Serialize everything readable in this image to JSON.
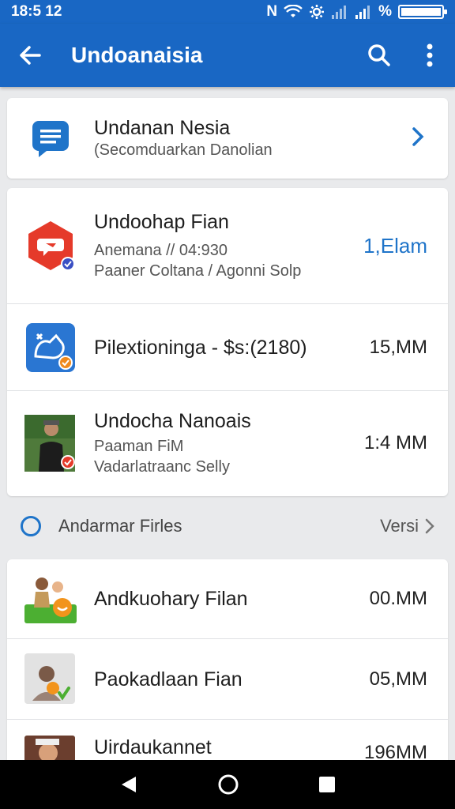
{
  "status": {
    "time": "18:5 12",
    "network_letter": "N",
    "percent": "%"
  },
  "app_bar": {
    "title": "Undoanaisia"
  },
  "top_card": {
    "title": "Undanan Nesia",
    "subtitle": "(Secomduarkan Danolian"
  },
  "main_list": [
    {
      "title": "Undoohap Fian",
      "sub1": "Anemana // 04:930",
      "sub2": "Paaner Coltana / Agonni Solp",
      "right": "1,Elam",
      "right_color": "#1f74c9"
    },
    {
      "title": "Pilextioninga - $s:(2180)",
      "right": "15,MM"
    },
    {
      "title": "Undocha Nanoais",
      "sub1": "Paaman FiM",
      "sub2": "Vadarlatraanc Selly",
      "right": "1:4 MM"
    }
  ],
  "section": {
    "label": "Andarmar Firles",
    "more": "Versi"
  },
  "files": [
    {
      "title": "Andkuohary Filan",
      "size": "00.MM"
    },
    {
      "title": "Paokadlaan Fian",
      "size": "05,MM"
    },
    {
      "title": "Uirdaukannet",
      "size": "196MM"
    }
  ],
  "colors": {
    "primary": "#1967c4",
    "accent": "#1f74c9",
    "background": "#e9eaec"
  }
}
